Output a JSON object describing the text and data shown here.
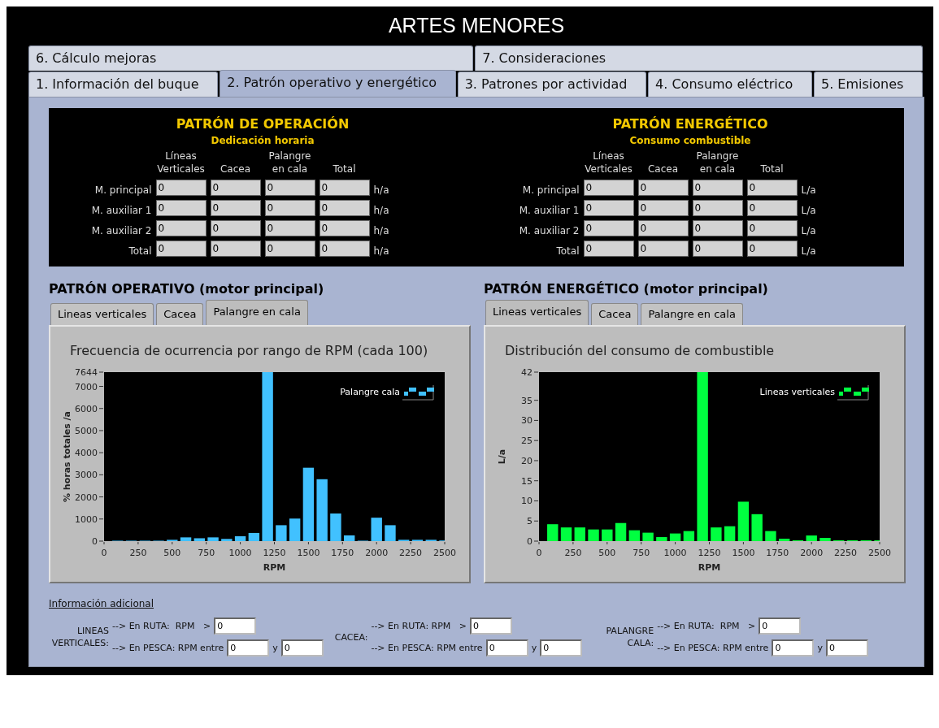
{
  "window": {
    "title": "ARTES MENORES"
  },
  "tab_rows": [
    [
      {
        "label": "6. Cálculo mejoras",
        "selected": false
      },
      {
        "label": "7. Consideraciones",
        "selected": false
      }
    ],
    [
      {
        "label": "1. Información del buque",
        "selected": false
      },
      {
        "label": "2. Patrón operativo y energético",
        "selected": true
      },
      {
        "label": "3. Patrones por actividad",
        "selected": false
      },
      {
        "label": "4. Consumo eléctrico",
        "selected": false
      },
      {
        "label": "5. Emisiones",
        "selected": false
      }
    ]
  ],
  "summary": [
    {
      "title": "PATRÓN DE OPERACIÓN",
      "subtitle": "Dedicación horaria",
      "columns": [
        "Líneas Verticales",
        "Cacea",
        "Palangre en cala",
        "Total"
      ],
      "rows": [
        {
          "label": "M. principal",
          "values": [
            "0",
            "0",
            "0",
            "0"
          ],
          "unit": "h/a"
        },
        {
          "label": "M. auxiliar 1",
          "values": [
            "0",
            "0",
            "0",
            "0"
          ],
          "unit": "h/a"
        },
        {
          "label": "M. auxiliar 2",
          "values": [
            "0",
            "0",
            "0",
            "0"
          ],
          "unit": "h/a"
        },
        {
          "label": "Total",
          "values": [
            "0",
            "0",
            "0",
            "0"
          ],
          "unit": "h/a"
        }
      ]
    },
    {
      "title": "PATRÓN ENERGÉTICO",
      "subtitle": "Consumo combustible",
      "columns": [
        "Líneas Verticales",
        "Cacea",
        "Palangre en cala",
        "Total"
      ],
      "rows": [
        {
          "label": "M. principal",
          "values": [
            "0",
            "0",
            "0",
            "0"
          ],
          "unit": "L/a"
        },
        {
          "label": "M. auxiliar 1",
          "values": [
            "0",
            "0",
            "0",
            "0"
          ],
          "unit": "L/a"
        },
        {
          "label": "M. auxiliar 2",
          "values": [
            "0",
            "0",
            "0",
            "0"
          ],
          "unit": "L/a"
        },
        {
          "label": "Total",
          "values": [
            "0",
            "0",
            "0",
            "0"
          ],
          "unit": "L/a"
        }
      ]
    }
  ],
  "panels": [
    {
      "heading": "PATRÓN OPERATIVO (motor principal)",
      "tabs": [
        {
          "label": "Lineas verticales",
          "selected": false
        },
        {
          "label": "Cacea",
          "selected": false
        },
        {
          "label": "Palangre en cala",
          "selected": true
        }
      ],
      "chart_data": {
        "type": "bar",
        "title": "Frecuencia de ocurrencia por rango de RPM (cada 100)",
        "xlabel": "RPM",
        "ylabel": "% horas totales /a",
        "x": [
          100,
          200,
          300,
          400,
          500,
          600,
          700,
          800,
          900,
          1000,
          1100,
          1200,
          1300,
          1400,
          1500,
          1600,
          1700,
          1800,
          1900,
          2000,
          2100,
          2200,
          2300,
          2400,
          2500
        ],
        "series": [
          {
            "name": "Palangre cala",
            "color": "#41c1ff",
            "values": [
              20,
              20,
              20,
              20,
              60,
              170,
              130,
              170,
              100,
              220,
              370,
              7644,
              720,
              1020,
              3320,
              2800,
              1250,
              260,
              20,
              1060,
              720,
              60,
              60,
              60,
              30
            ]
          }
        ],
        "xlim": [
          0,
          2500
        ],
        "ylim": [
          0,
          7644
        ],
        "xticks": [
          0,
          250,
          500,
          750,
          1000,
          1250,
          1500,
          1750,
          2000,
          2250,
          2500
        ],
        "yticks": [
          0,
          1000,
          2000,
          3000,
          4000,
          5000,
          6000,
          7000,
          7644
        ]
      }
    },
    {
      "heading": "PATRÓN ENERGÉTICO (motor principal)",
      "tabs": [
        {
          "label": "Lineas verticales",
          "selected": true
        },
        {
          "label": "Cacea",
          "selected": false
        },
        {
          "label": "Palangre en cala",
          "selected": false
        }
      ],
      "chart_data": {
        "type": "bar",
        "title": "Distribución del consumo de combustible",
        "xlabel": "RPM",
        "ylabel": "L/a",
        "x": [
          100,
          200,
          300,
          400,
          500,
          600,
          700,
          800,
          900,
          1000,
          1100,
          1200,
          1300,
          1400,
          1500,
          1600,
          1700,
          1800,
          1900,
          2000,
          2100,
          2200,
          2300,
          2400,
          2500
        ],
        "series": [
          {
            "name": "Lineas verticales",
            "color": "#00ff40",
            "values": [
              4.2,
              3.4,
              3.4,
              2.9,
              2.9,
              4.5,
              2.7,
              2.1,
              1,
              1.9,
              2.5,
              42,
              3.4,
              3.7,
              9.8,
              6.7,
              2.5,
              0.6,
              0.2,
              1.4,
              0.8,
              0.2,
              0.2,
              0.2,
              0.2
            ]
          }
        ],
        "xlim": [
          0,
          2500
        ],
        "ylim": [
          0,
          42
        ],
        "xticks": [
          0,
          250,
          500,
          750,
          1000,
          1250,
          1500,
          1750,
          2000,
          2250,
          2500
        ],
        "yticks": [
          0,
          5,
          10,
          15,
          20,
          25,
          30,
          35,
          42
        ]
      }
    }
  ],
  "additional_info": {
    "title": "Información adicional",
    "groups": [
      {
        "label": "LINEAS VERTICALES:",
        "route_label": "--> En RUTA:  RPM   >",
        "route_value": "0",
        "fishing_label": "--> En PESCA: RPM entre",
        "fishing_from": "0",
        "and": "y",
        "fishing_to": "0"
      },
      {
        "label": "CACEA:",
        "route_label": "--> En RUTA: RPM   >",
        "route_value": "0",
        "fishing_label": "--> En PESCA: RPM entre",
        "fishing_from": "0",
        "and": "y",
        "fishing_to": "0"
      },
      {
        "label": "PALANGRE CALA:",
        "route_label": "--> En RUTA:  RPM   >",
        "route_value": "0",
        "fishing_label": "--> En PESCA: RPM entre",
        "fishing_from": "0",
        "and": "y",
        "fishing_to": "0"
      }
    ]
  }
}
